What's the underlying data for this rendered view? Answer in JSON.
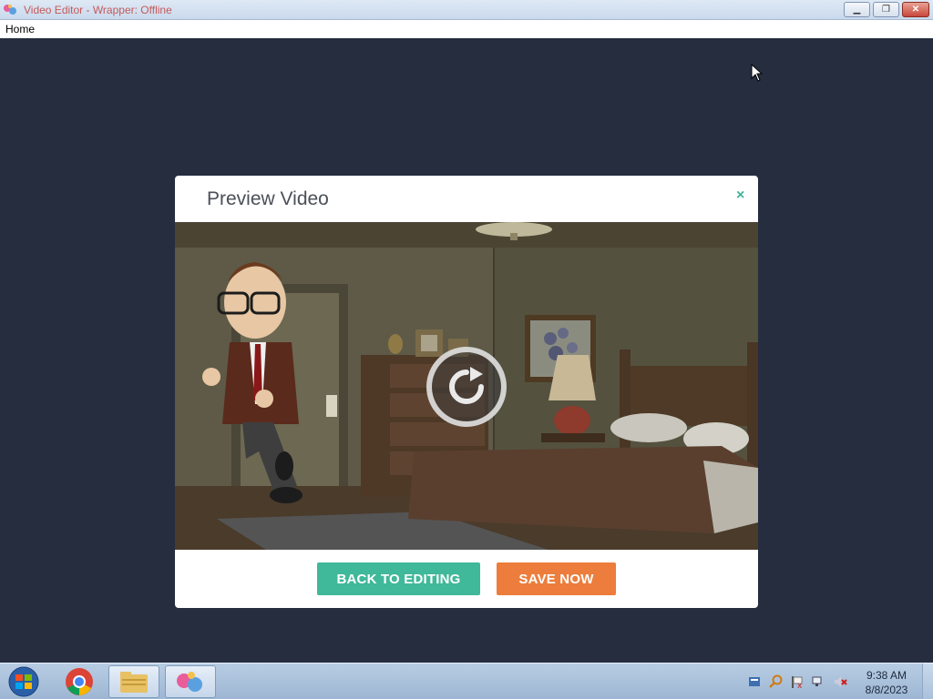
{
  "window": {
    "title": "Video Editor - Wrapper: Offline",
    "minimize_icon": "minimize-icon",
    "maximize_icon": "restore-icon",
    "close_icon": "close-icon"
  },
  "menu": {
    "items": [
      "Home"
    ]
  },
  "modal": {
    "title": "Preview Video",
    "close_glyph": "×",
    "replay_icon": "replay-icon",
    "back_label": "BACK TO EDITING",
    "save_label": "SAVE NOW"
  },
  "taskbar": {
    "time": "9:38 AM",
    "date": "8/8/2023",
    "pinned": [
      "start-orb-icon",
      "chrome-icon",
      "file-explorer-icon",
      "wrapper-app-icon"
    ],
    "tray": [
      "action-center-icon",
      "search-icon",
      "flag-icon",
      "network-icon",
      "volume-muted-icon"
    ]
  },
  "colors": {
    "accent_green": "#40b89a",
    "accent_orange": "#ec7d3c",
    "background": "#252d3f"
  }
}
